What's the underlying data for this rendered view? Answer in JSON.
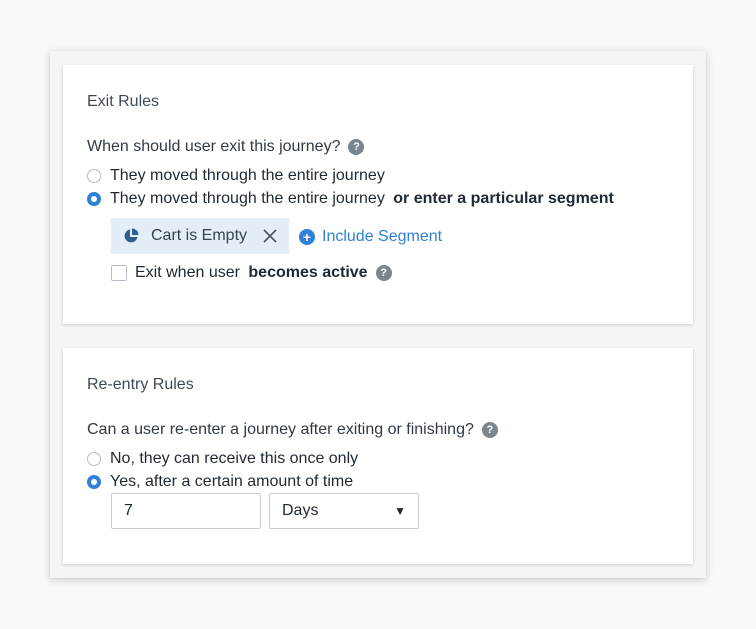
{
  "exit_rules": {
    "title": "Exit Rules",
    "question": "When should user exit this journey?",
    "options": [
      {
        "label": "They moved through the entire journey",
        "label_bold": "",
        "checked": false
      },
      {
        "label": "They moved through the entire journey ",
        "label_bold": "or enter a particular segment",
        "checked": true
      }
    ],
    "segment_chip": {
      "label": "Cart is Empty",
      "icon": "pie-chart-icon"
    },
    "include_segment_label": "Include Segment",
    "exit_when_active": {
      "label": "Exit when user ",
      "label_bold": "becomes active",
      "checked": false
    }
  },
  "reentry_rules": {
    "title": "Re-entry Rules",
    "question": "Can a user re-enter a journey after exiting or finishing?",
    "options": [
      {
        "label": "No, they can receive this once only",
        "checked": false
      },
      {
        "label": "Yes, after a certain amount of time",
        "checked": true
      }
    ],
    "amount_value": "7",
    "unit_selected": "Days"
  },
  "icons": {
    "help": "?",
    "close": "✕",
    "plus": "+",
    "caret": "▼"
  },
  "colors": {
    "accent": "#2f80d6",
    "chip_bg": "#e3eef9",
    "help_icon": "#7b858f"
  }
}
